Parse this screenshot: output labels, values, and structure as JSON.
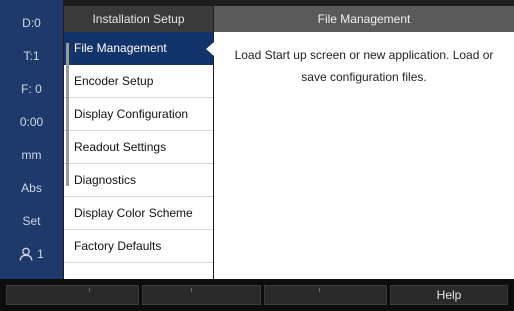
{
  "status": {
    "items": [
      "D:0",
      "T:1",
      "F:  0",
      "0:00",
      "mm",
      "Abs",
      "Set",
      "1"
    ],
    "user_icon": "user-icon",
    "color": "#1d3a6a"
  },
  "menu": {
    "header": "Installation Setup",
    "items": [
      {
        "label": "File Management",
        "selected": true
      },
      {
        "label": "Encoder Setup",
        "selected": false
      },
      {
        "label": "Display Configuration",
        "selected": false
      },
      {
        "label": "Readout Settings",
        "selected": false
      },
      {
        "label": "Diagnostics",
        "selected": false
      },
      {
        "label": "Display Color Scheme",
        "selected": false
      },
      {
        "label": "Factory Defaults",
        "selected": false
      }
    ]
  },
  "content": {
    "header": "File Management",
    "text": "Load Start up screen or new application.  Load or save configuration files."
  },
  "softkeys": [
    "",
    "",
    "",
    "Help"
  ],
  "colors": {
    "selected_item": "#12346a",
    "status_column": "#1d3a6a"
  }
}
